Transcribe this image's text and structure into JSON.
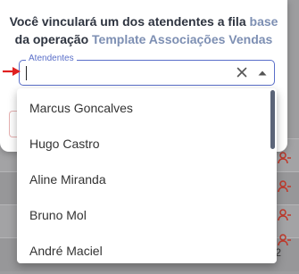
{
  "modal": {
    "title_line1_prefix": "Você vinculará um dos atendentes a fila ",
    "title_line1_highlight": "base",
    "title_line2_prefix": "da operação ",
    "title_line2_highlight": "Template Associações Vendas"
  },
  "field": {
    "label": "Atendentes",
    "value": "",
    "placeholder": ""
  },
  "icons": {
    "clear": "close-icon",
    "toggle": "caret-up-icon",
    "annotation": "red-arrow-icon",
    "row_action": "remove-user-icon"
  },
  "dropdown": {
    "options": [
      "Marcus Goncalves",
      "Hugo Castro",
      "Aline Miranda",
      "Bruno Mol",
      "André Maciel"
    ]
  },
  "background": {
    "row_badge": "2"
  },
  "colors": {
    "accent": "#5a6fc9",
    "highlight_text": "#7d8fb3",
    "annotation": "#e02020",
    "danger": "#c0392b"
  }
}
